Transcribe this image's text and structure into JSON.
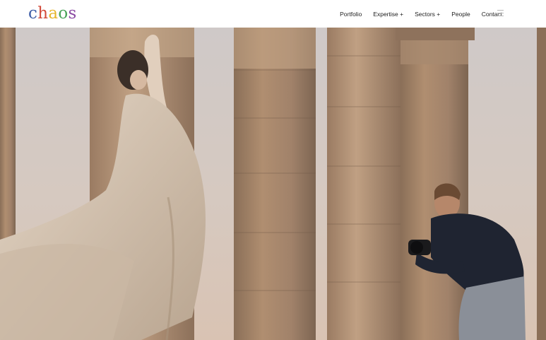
{
  "header": {
    "logo": {
      "letters": [
        "c",
        "h",
        "a",
        "o",
        "s"
      ],
      "letter_colors": [
        "#3f5fa8",
        "#d24a3a",
        "#e7b52a",
        "#4aa35a",
        "#8a4aa3"
      ]
    },
    "nav": {
      "items": [
        "Portfolio",
        "Expertise +",
        "Sectors +",
        "People",
        "Contact"
      ]
    },
    "menu_icon": "hamburger-icon"
  },
  "hero": {
    "content": "dancer-and-photographer-among-ancient-columns"
  }
}
